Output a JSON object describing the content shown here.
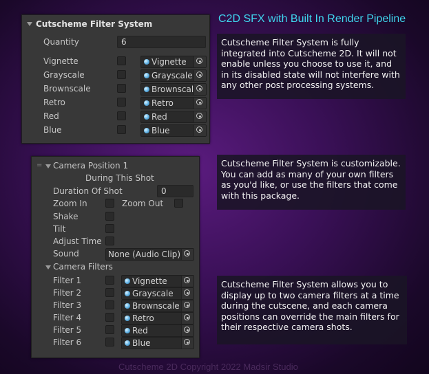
{
  "title": "C2D SFX with Built In Render Pipeline",
  "copyright": "Cutscheme 2D Copyright 2022 Madsir Studio",
  "filter_panel": {
    "header": "Cutscheme Filter System",
    "quantity_label": "Quantity",
    "quantity_value": "6",
    "rows": [
      {
        "label": "Vignette",
        "value": "Vignette"
      },
      {
        "label": "Grayscale",
        "value": "Grayscale"
      },
      {
        "label": "Brownscale",
        "value": "Brownscale"
      },
      {
        "label": "Retro",
        "value": "Retro"
      },
      {
        "label": "Red",
        "value": "Red"
      },
      {
        "label": "Blue",
        "value": "Blue"
      }
    ]
  },
  "camera_panel": {
    "header": "Camera Position 1",
    "subheader": "During This Shot",
    "duration_label": "Duration Of Shot",
    "duration_value": "0",
    "zoom_in_label": "Zoom In",
    "zoom_out_label": "Zoom Out",
    "shake_label": "Shake",
    "tilt_label": "Tilt",
    "adjust_time_label": "Adjust Time",
    "sound_label": "Sound",
    "sound_value": "None (Audio Clip)",
    "camera_filters_label": "Camera Filters",
    "filters": [
      {
        "label": "Filter 1",
        "value": "Vignette"
      },
      {
        "label": "Filter 2",
        "value": "Grayscale"
      },
      {
        "label": "Filter 3",
        "value": "Brownscale"
      },
      {
        "label": "Filter 4",
        "value": "Retro"
      },
      {
        "label": "Filter 5",
        "value": "Red"
      },
      {
        "label": "Filter 6",
        "value": "Blue"
      }
    ]
  },
  "info": {
    "box1": "Cutscheme Filter System is fully integrated into Cutscheme 2D. It will not enable unless you choose to use it, and in its disabled state will not interfere with any other post processing systems.",
    "box2": "Cutscheme Filter System is customizable. You can add as many of your own filters as you'd like, or use the filters that come with this package.",
    "box3": "Cutscheme Filter System allows you to display up to two camera filters at a time during the cutscene, and each camera positions can override the main filters for their respective camera shots."
  },
  "colors": {
    "title": "#3fd6ee",
    "panel_bg": "#383838",
    "accent_dot": "#5db0e4"
  }
}
